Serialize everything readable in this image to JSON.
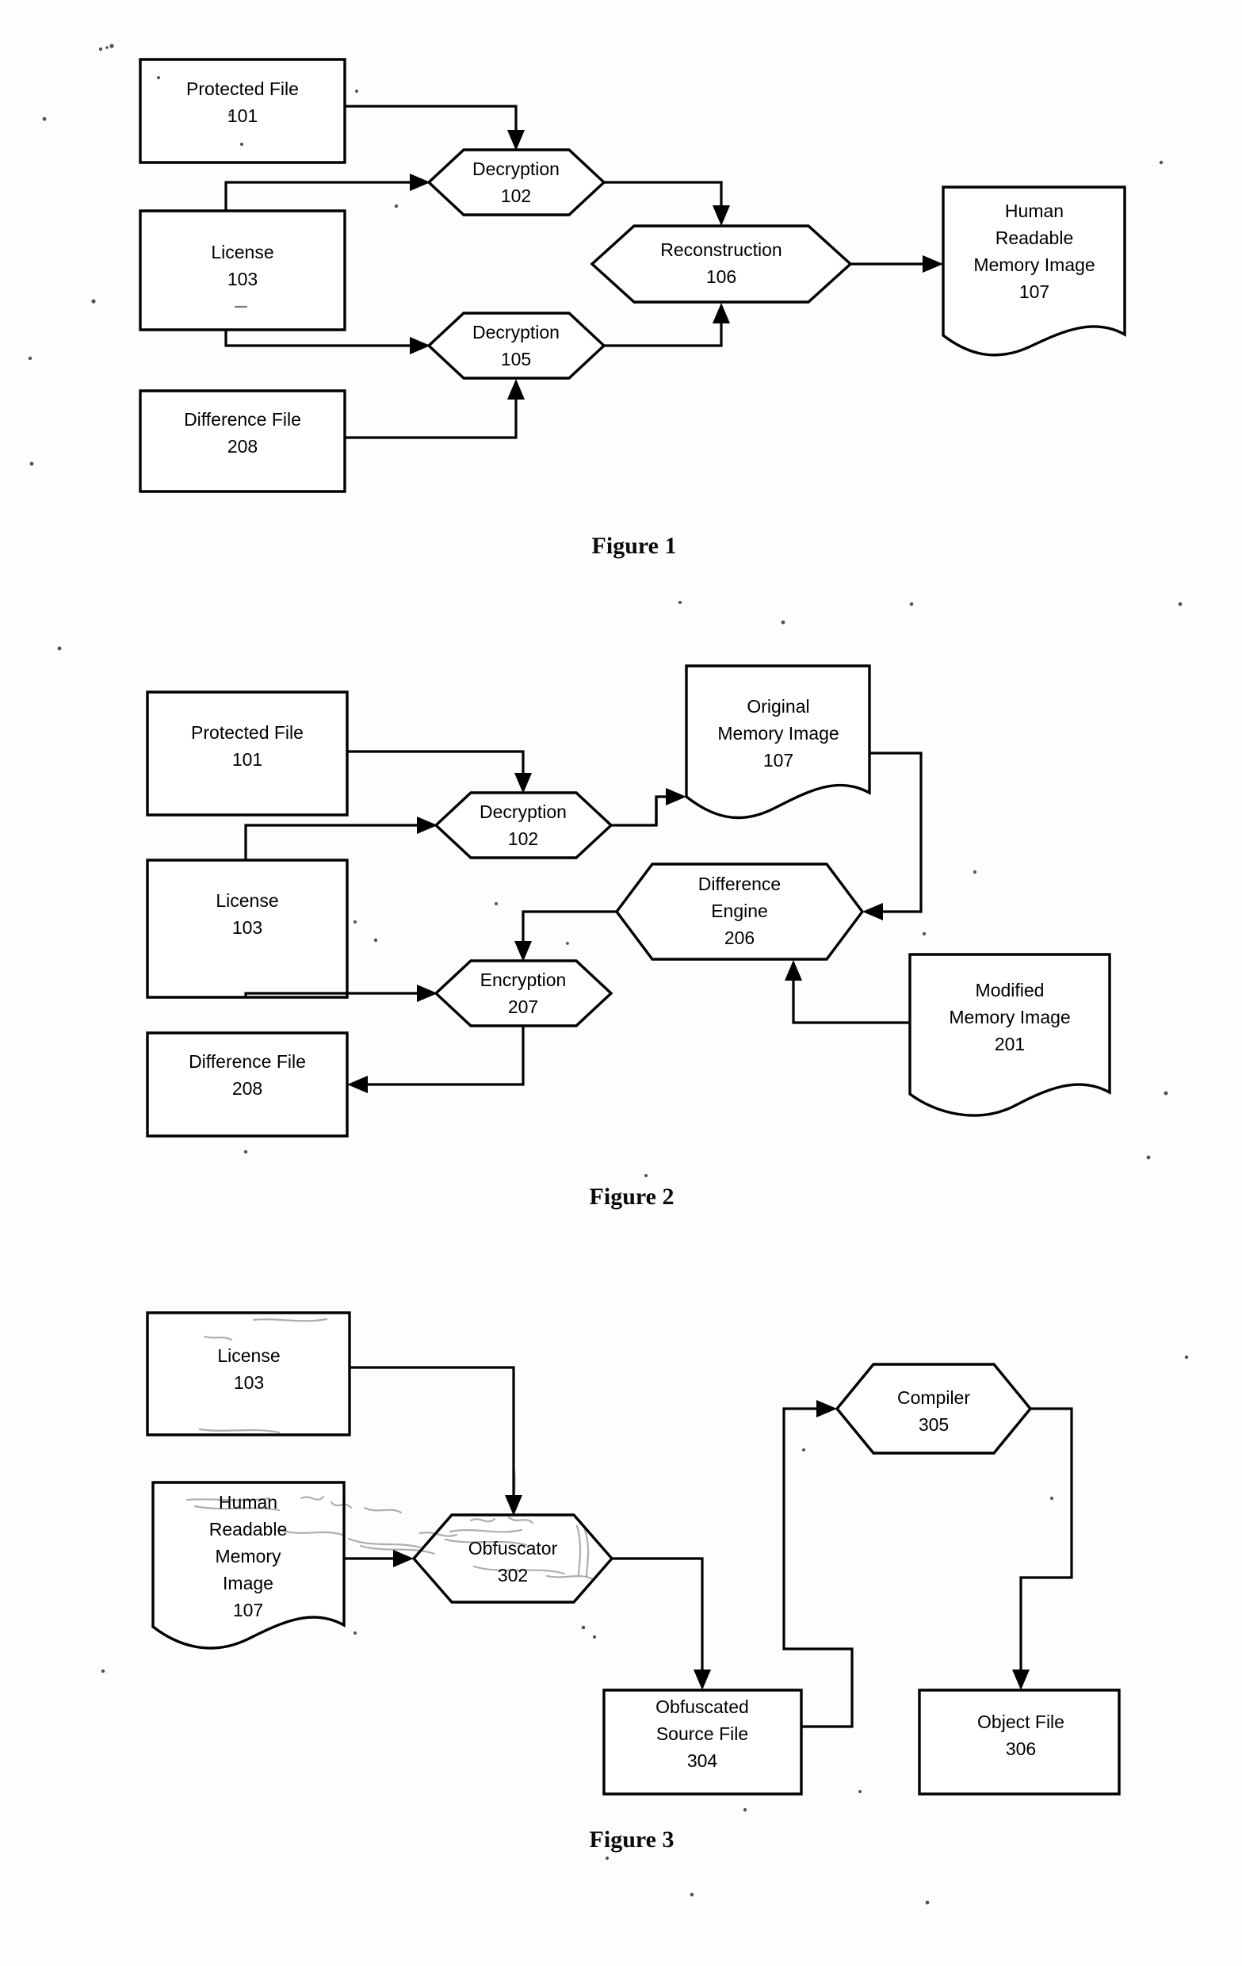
{
  "document": {
    "kind": "patent-drawing-sheet",
    "figures": [
      {
        "caption": "Figure 1",
        "nodes": [
          {
            "id": "f1-protected-file",
            "lines": [
              "Protected File",
              "101"
            ],
            "shape": "document-cut-corner"
          },
          {
            "id": "f1-license",
            "lines": [
              "License",
              "103"
            ],
            "shape": "document-cut-corner"
          },
          {
            "id": "f1-difference-file",
            "lines": [
              "Difference File",
              "208"
            ],
            "shape": "document-cut-corner"
          },
          {
            "id": "f1-decryption-102",
            "lines": [
              "Decryption",
              "102"
            ],
            "shape": "hexagon"
          },
          {
            "id": "f1-decryption-105",
            "lines": [
              "Decryption",
              "105"
            ],
            "shape": "hexagon"
          },
          {
            "id": "f1-reconstruction-106",
            "lines": [
              "Reconstruction",
              "106"
            ],
            "shape": "hexagon"
          },
          {
            "id": "f1-human-readable-107",
            "lines": [
              "Human",
              "Readable",
              "Memory Image",
              "107"
            ],
            "shape": "wavy-document"
          }
        ],
        "edges": [
          {
            "from": "f1-protected-file",
            "to": "f1-decryption-102"
          },
          {
            "from": "f1-license",
            "to": "f1-decryption-102"
          },
          {
            "from": "f1-license",
            "to": "f1-decryption-105"
          },
          {
            "from": "f1-difference-file",
            "to": "f1-decryption-105"
          },
          {
            "from": "f1-decryption-102",
            "to": "f1-reconstruction-106"
          },
          {
            "from": "f1-decryption-105",
            "to": "f1-reconstruction-106"
          },
          {
            "from": "f1-reconstruction-106",
            "to": "f1-human-readable-107"
          }
        ]
      },
      {
        "caption": "Figure 2",
        "nodes": [
          {
            "id": "f2-protected-file",
            "lines": [
              "Protected File",
              "101"
            ],
            "shape": "document-cut-corner"
          },
          {
            "id": "f2-license",
            "lines": [
              "License",
              "103"
            ],
            "shape": "document-cut-corner"
          },
          {
            "id": "f2-difference-file",
            "lines": [
              "Difference File",
              "208"
            ],
            "shape": "document-cut-corner"
          },
          {
            "id": "f2-decryption-102",
            "lines": [
              "Decryption",
              "102"
            ],
            "shape": "hexagon"
          },
          {
            "id": "f2-encryption-207",
            "lines": [
              "Encryption",
              "207"
            ],
            "shape": "hexagon"
          },
          {
            "id": "f2-difference-engine-206",
            "lines": [
              "Difference",
              "Engine",
              "206"
            ],
            "shape": "hexagon"
          },
          {
            "id": "f2-original-memory-107",
            "lines": [
              "Original",
              "Memory Image",
              "107"
            ],
            "shape": "wavy-document"
          },
          {
            "id": "f2-modified-memory-201",
            "lines": [
              "Modified",
              "Memory Image",
              "201"
            ],
            "shape": "wavy-document"
          }
        ],
        "edges": [
          {
            "from": "f2-protected-file",
            "to": "f2-decryption-102"
          },
          {
            "from": "f2-license",
            "to": "f2-decryption-102"
          },
          {
            "from": "f2-license",
            "to": "f2-encryption-207"
          },
          {
            "from": "f2-decryption-102",
            "to": "f2-original-memory-107"
          },
          {
            "from": "f2-original-memory-107",
            "to": "f2-difference-engine-206"
          },
          {
            "from": "f2-modified-memory-201",
            "to": "f2-difference-engine-206"
          },
          {
            "from": "f2-difference-engine-206",
            "to": "f2-encryption-207"
          },
          {
            "from": "f2-encryption-207",
            "to": "f2-difference-file"
          }
        ]
      },
      {
        "caption": "Figure 3",
        "nodes": [
          {
            "id": "f3-license",
            "lines": [
              "License",
              "103"
            ],
            "shape": "document-cut-corner"
          },
          {
            "id": "f3-human-readable-107",
            "lines": [
              "Human",
              "Readable",
              "Memory",
              "Image",
              "107"
            ],
            "shape": "wavy-document"
          },
          {
            "id": "f3-obfuscator-302",
            "lines": [
              "Obfuscator",
              "302"
            ],
            "shape": "hexagon"
          },
          {
            "id": "f3-compiler-305",
            "lines": [
              "Compiler",
              "305"
            ],
            "shape": "hexagon"
          },
          {
            "id": "f3-obfuscated-source-304",
            "lines": [
              "Obfuscated",
              "Source File",
              "304"
            ],
            "shape": "document-cut-corner"
          },
          {
            "id": "f3-object-file-306",
            "lines": [
              "Object File",
              "306"
            ],
            "shape": "document-cut-corner"
          }
        ],
        "edges": [
          {
            "from": "f3-license",
            "to": "f3-obfuscator-302"
          },
          {
            "from": "f3-human-readable-107",
            "to": "f3-obfuscator-302"
          },
          {
            "from": "f3-obfuscator-302",
            "to": "f3-obfuscated-source-304"
          },
          {
            "from": "f3-obfuscated-source-304",
            "to": "f3-compiler-305"
          },
          {
            "from": "f3-compiler-305",
            "to": "f3-object-file-306"
          }
        ]
      }
    ]
  },
  "figure1": {
    "caption": "Figure 1",
    "protected_file": {
      "line1": "Protected File",
      "line2": "101"
    },
    "license": {
      "line1": "License",
      "line2": "103"
    },
    "difference_file": {
      "line1": "Difference File",
      "line2": "208"
    },
    "decryption_102": {
      "line1": "Decryption",
      "line2": "102"
    },
    "decryption_105": {
      "line1": "Decryption",
      "line2": "105"
    },
    "reconstruction_106": {
      "line1": "Reconstruction",
      "line2": "106"
    },
    "human_readable_107": {
      "line1": "Human",
      "line2": "Readable",
      "line3": "Memory Image",
      "line4": "107"
    }
  },
  "figure2": {
    "caption": "Figure 2",
    "protected_file": {
      "line1": "Protected File",
      "line2": "101"
    },
    "license": {
      "line1": "License",
      "line2": "103"
    },
    "difference_file": {
      "line1": "Difference File",
      "line2": "208"
    },
    "decryption_102": {
      "line1": "Decryption",
      "line2": "102"
    },
    "encryption_207": {
      "line1": "Encryption",
      "line2": "207"
    },
    "difference_engine_206": {
      "line1": "Difference",
      "line2": "Engine",
      "line3": "206"
    },
    "original_memory_107": {
      "line1": "Original",
      "line2": "Memory Image",
      "line3": "107"
    },
    "modified_memory_201": {
      "line1": "Modified",
      "line2": "Memory Image",
      "line3": "201"
    }
  },
  "figure3": {
    "caption": "Figure 3",
    "license": {
      "line1": "License",
      "line2": "103"
    },
    "human_readable_107": {
      "line1": "Human",
      "line2": "Readable",
      "line3": "Memory",
      "line4": "Image",
      "line5": "107"
    },
    "obfuscator_302": {
      "line1": "Obfuscator",
      "line2": "302"
    },
    "compiler_305": {
      "line1": "Compiler",
      "line2": "305"
    },
    "obfuscated_source_304": {
      "line1": "Obfuscated",
      "line2": "Source File",
      "line3": "304"
    },
    "object_file_306": {
      "line1": "Object File",
      "line2": "306"
    }
  },
  "colors": {
    "ink": "#000000",
    "paper": "#fdfdfb"
  }
}
